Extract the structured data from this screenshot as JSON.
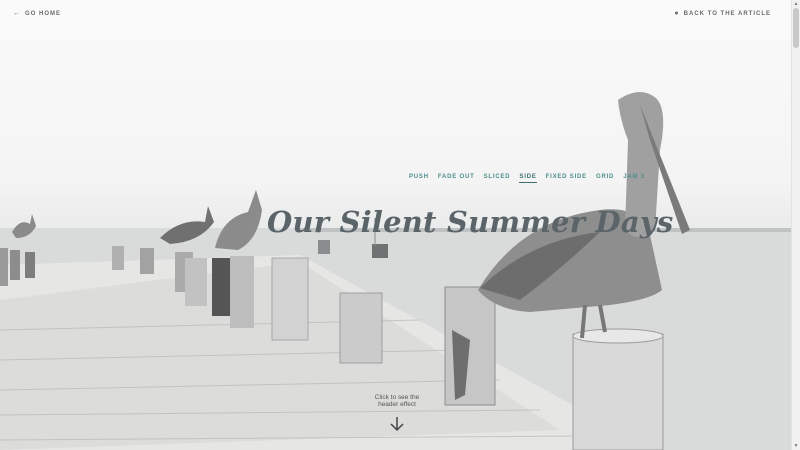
{
  "header": {
    "go_home": "GO HOME",
    "back_to_article": "BACK TO THE ARTICLE"
  },
  "nav": {
    "items": [
      "PUSH",
      "FADE OUT",
      "SLICED",
      "SIDE",
      "FIXED SIDE",
      "GRID",
      "JAM 3"
    ],
    "active": "SIDE"
  },
  "hero": {
    "title": "Our Silent Summer Days",
    "hint": "Click to see the header effect"
  },
  "icons": {
    "go_home": "arrow-left-icon",
    "back": "drop-icon",
    "scroll": "arrow-down-icon"
  },
  "colors": {
    "accent": "#4c8f8c",
    "title": "#5a6469"
  }
}
